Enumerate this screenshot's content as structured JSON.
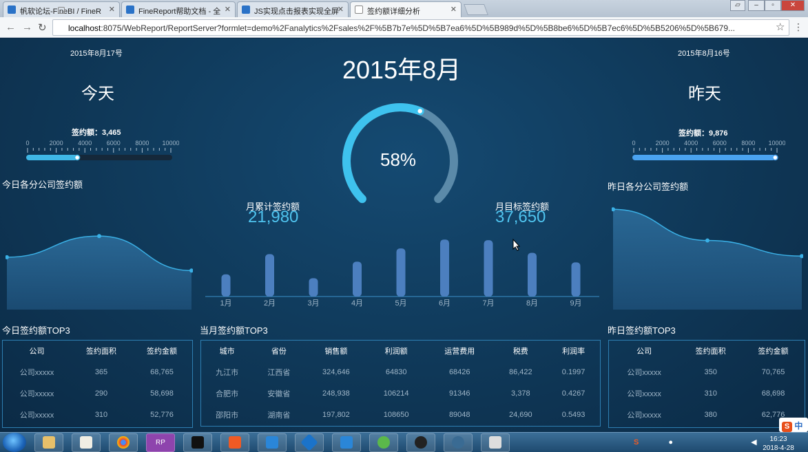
{
  "browser": {
    "tabs": [
      {
        "label": "帆软论坛-FineBI / FineR"
      },
      {
        "label": "FineReport帮助文档 - 全"
      },
      {
        "label": "JS实现点击报表实现全屏"
      },
      {
        "label": "签约额详细分析"
      }
    ],
    "url_host": "localhost",
    "url_rest": ":8075/WebReport/ReportServer?formlet=demo%2Fanalytics%2Fsales%2F%5B7b7e%5D%5B7ea6%5D%5B989d%5D%5B8be6%5D%5B7ec6%5D%5B5206%5D%5B679..."
  },
  "today": {
    "date": "2015年8月17号",
    "label": "今天",
    "sign_text": "签约额：3,465",
    "sign_value": 3465,
    "scale_ticks": [
      "0",
      "2000",
      "4000",
      "6000",
      "8000",
      "10000"
    ],
    "scale_max": 10000
  },
  "yesterday": {
    "date": "2015年8月16号",
    "label": "昨天",
    "sign_text": "签约额：9,876",
    "sign_value": 9876,
    "scale_ticks": [
      "0",
      "2000",
      "4000",
      "6000",
      "8000",
      "10000"
    ],
    "scale_max": 10000
  },
  "center": {
    "month_title": "2015年8月",
    "gauge_text": "58%",
    "gauge_value": 0.58,
    "cum_label": "月累计签约额",
    "cum_value": "21,980",
    "target_label": "月目标签约额",
    "target_value": "37,650"
  },
  "sections": {
    "today_company": "今日各分公司签约额",
    "yesterday_company": "昨日各分公司签约额",
    "today_top3": "今日签约额TOP3",
    "month_top3": "当月签约额TOP3",
    "yesterday_top3": "昨日签约额TOP3"
  },
  "chart_data": [
    {
      "type": "bar",
      "categories": [
        "1月",
        "2月",
        "3月",
        "4月",
        "5月",
        "6月",
        "7月",
        "8月",
        "9月"
      ],
      "values": [
        35,
        67,
        29,
        55,
        76,
        90,
        89,
        69,
        54
      ],
      "title": ""
    },
    {
      "type": "area",
      "x": [
        0,
        1,
        2
      ],
      "values": [
        0.47,
        0.66,
        0.35
      ],
      "title": "今日各分公司签约额"
    },
    {
      "type": "area",
      "x": [
        0,
        1,
        2
      ],
      "values": [
        0.9,
        0.62,
        0.48
      ],
      "title": "昨日各分公司签约额"
    }
  ],
  "today_table": {
    "headers": [
      "公司",
      "签约面积",
      "签约金额"
    ],
    "rows": [
      [
        "公司xxxxx",
        "365",
        "68,765"
      ],
      [
        "公司xxxxx",
        "290",
        "58,698"
      ],
      [
        "公司xxxxx",
        "310",
        "52,776"
      ]
    ]
  },
  "yesterday_table": {
    "headers": [
      "公司",
      "签约面积",
      "签约金额"
    ],
    "rows": [
      [
        "公司xxxxx",
        "350",
        "70,765"
      ],
      [
        "公司xxxxx",
        "310",
        "68,698"
      ],
      [
        "公司xxxxx",
        "380",
        "62,776"
      ]
    ]
  },
  "month_table": {
    "headers": [
      "城市",
      "省份",
      "销售额",
      "利润额",
      "运营费用",
      "税费",
      "利润率"
    ],
    "rows": [
      [
        "九江市",
        "江西省",
        "324,646",
        "64830",
        "68426",
        "86,422",
        "0.1997"
      ],
      [
        "合肥市",
        "安徽省",
        "248,938",
        "106214",
        "91346",
        "3,378",
        "0.4267"
      ],
      [
        "邵阳市",
        "湖南省",
        "197,802",
        "108650",
        "89048",
        "24,690",
        "0.5493"
      ]
    ]
  },
  "taskbar": {
    "time": "16:23",
    "date": "2018-4-28",
    "ime": "中",
    "rp_label": "RP"
  }
}
